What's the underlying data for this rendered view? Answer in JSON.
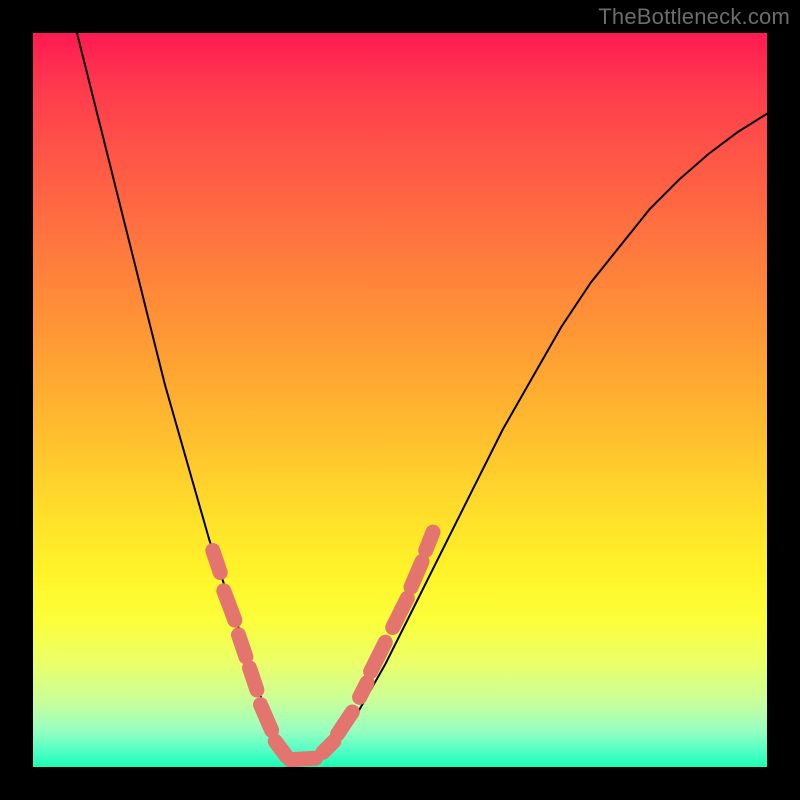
{
  "watermark": "TheBottleneck.com",
  "colors": {
    "frame": "#000000",
    "curve": "#000000",
    "marker": "#e4746e",
    "gradient_top": "#ff1a52",
    "gradient_bottom": "#19ffb3"
  },
  "chart_data": {
    "type": "line",
    "title": "",
    "xlabel": "",
    "ylabel": "",
    "xlim": [
      0,
      100
    ],
    "ylim": [
      0,
      100
    ],
    "note": "Axes are hidden. x is an arbitrary parameter (roughly % of horizontal range). y is the curve height as % of vertical range (0 at bottom, 100 at top). Values estimated from pixels.",
    "series": [
      {
        "name": "bottleneck-curve",
        "x": [
          6,
          8,
          10,
          12,
          14,
          16,
          18,
          20,
          22,
          24,
          26,
          28,
          30,
          31.5,
          33,
          34.5,
          36,
          40,
          44,
          48,
          52,
          56,
          60,
          64,
          68,
          72,
          76,
          80,
          84,
          88,
          92,
          96,
          100
        ],
        "y": [
          100,
          92,
          84,
          76,
          68,
          60,
          52,
          45,
          38,
          31,
          25,
          19,
          13,
          8,
          4,
          1.5,
          0.5,
          2,
          7,
          14,
          22,
          30,
          38,
          46,
          53,
          60,
          66,
          71,
          76,
          80,
          83.5,
          86.5,
          89
        ]
      }
    ],
    "markers": {
      "name": "highlight-segments",
      "note": "Short thick coral-colored segments overlayed on the curve near the minimum region. Each entry is a pair of endpoints on the curve in the same x/y % coordinate space.",
      "segments": [
        {
          "x1": 24.5,
          "y1": 29.5,
          "x2": 25.5,
          "y2": 26.5
        },
        {
          "x1": 26.0,
          "y1": 24.0,
          "x2": 27.5,
          "y2": 20.0
        },
        {
          "x1": 28.0,
          "y1": 18.0,
          "x2": 29.0,
          "y2": 15.0
        },
        {
          "x1": 29.5,
          "y1": 13.5,
          "x2": 30.5,
          "y2": 10.5
        },
        {
          "x1": 31.0,
          "y1": 8.5,
          "x2": 32.5,
          "y2": 5.0
        },
        {
          "x1": 33.0,
          "y1": 3.5,
          "x2": 34.5,
          "y2": 1.5
        },
        {
          "x1": 35.0,
          "y1": 1.0,
          "x2": 38.5,
          "y2": 1.2
        },
        {
          "x1": 39.5,
          "y1": 2.0,
          "x2": 41.0,
          "y2": 3.5
        },
        {
          "x1": 41.5,
          "y1": 4.5,
          "x2": 43.5,
          "y2": 7.5
        },
        {
          "x1": 44.5,
          "y1": 9.5,
          "x2": 45.5,
          "y2": 11.5
        },
        {
          "x1": 46.0,
          "y1": 13.0,
          "x2": 48.0,
          "y2": 17.0
        },
        {
          "x1": 49.0,
          "y1": 19.0,
          "x2": 51.0,
          "y2": 23.0
        },
        {
          "x1": 51.5,
          "y1": 24.5,
          "x2": 53.0,
          "y2": 28.0
        },
        {
          "x1": 53.5,
          "y1": 29.5,
          "x2": 54.5,
          "y2": 32.0
        }
      ]
    }
  }
}
